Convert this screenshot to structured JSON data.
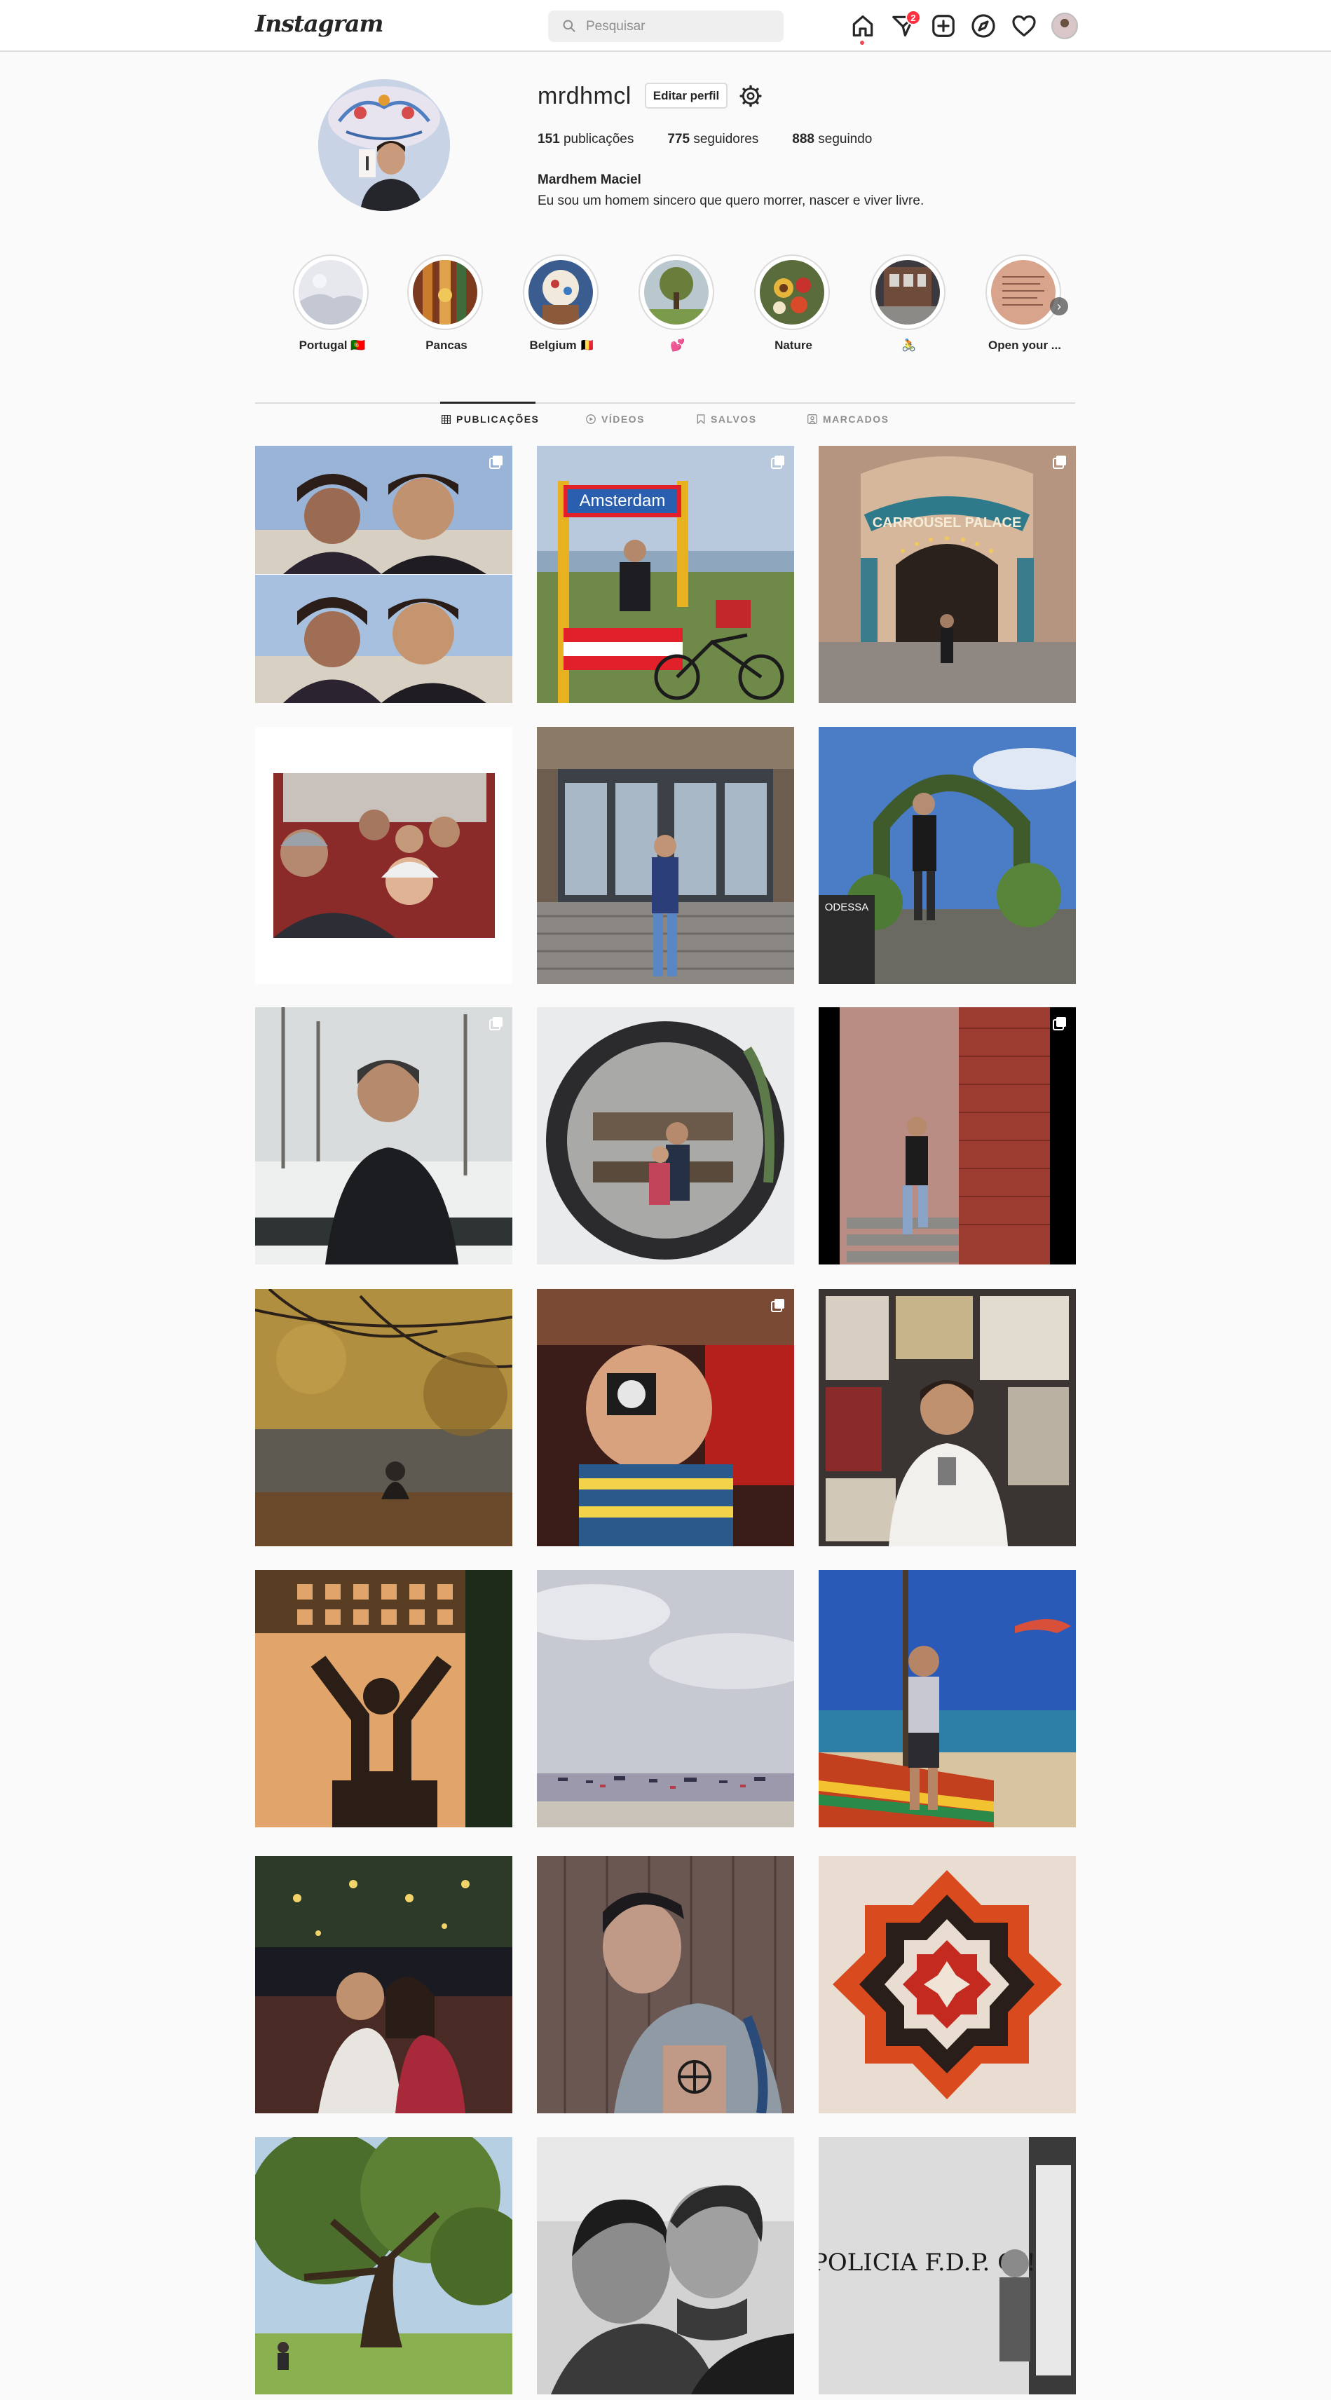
{
  "nav": {
    "logo": "Instagram",
    "search_placeholder": "Pesquisar",
    "notification_count": "2",
    "icons": [
      "home-icon",
      "direct-icon",
      "new-post-icon",
      "explore-icon",
      "activity-icon"
    ]
  },
  "profile": {
    "username": "mrdhmcl",
    "edit_label": "Editar perfil",
    "posts_count": "151",
    "posts_label": "publicações",
    "followers_count": "775",
    "followers_label": "seguidores",
    "following_count": "888",
    "following_label": "seguindo",
    "full_name": "Mardhem Maciel",
    "bio": "Eu sou um homem sincero que quero morrer, nascer e viver livre."
  },
  "highlights": [
    {
      "label": "Portugal 🇵🇹"
    },
    {
      "label": "Pancas"
    },
    {
      "label": "Belgium 🇧🇪"
    },
    {
      "label": "💕"
    },
    {
      "label": "Nature"
    },
    {
      "label": "🚴"
    },
    {
      "label": "Open your ..."
    }
  ],
  "tabs": [
    {
      "label": "PUBLICAÇÕES",
      "active": true
    },
    {
      "label": "VÍDEOS",
      "active": false
    },
    {
      "label": "SALVOS",
      "active": false
    },
    {
      "label": "MARCADOS",
      "active": false
    }
  ],
  "posts": [
    {
      "subject": "couple selfie at beach",
      "multi": true
    },
    {
      "subject": "Amsterdam sign with bicycle",
      "sign_text": "Amsterdam",
      "multi": true
    },
    {
      "subject": "Carrousel Palace entrance",
      "sign_text": "CARROUSEL PALACE",
      "multi": true
    },
    {
      "subject": "family selfie in tram",
      "multi": false
    },
    {
      "subject": "man in front of glass doors",
      "multi": false
    },
    {
      "subject": "man under garden arch",
      "sign_text": "ODESSA",
      "multi": false
    },
    {
      "subject": "man in snowy park",
      "multi": true
    },
    {
      "subject": "round mirror reflection",
      "multi": false
    },
    {
      "subject": "man on brick stairs",
      "multi": true
    },
    {
      "subject": "autumn lake silhouette",
      "multi": false
    },
    {
      "subject": "boy with monocle",
      "multi": true
    },
    {
      "subject": "man by poster wall",
      "multi": false
    },
    {
      "subject": "shadow on wall",
      "multi": false
    },
    {
      "subject": "boats on grey sea",
      "multi": false
    },
    {
      "subject": "man on boat at beach",
      "multi": false
    },
    {
      "subject": "couple kiss at night",
      "multi": false
    },
    {
      "subject": "man with tattoo",
      "multi": false
    },
    {
      "subject": "woven mandala",
      "multi": false
    },
    {
      "subject": "big tree in park",
      "multi": false
    },
    {
      "subject": "black and white kiss",
      "multi": false
    },
    {
      "subject": "graffiti wall",
      "sign_text": "POLICIA F.D.P. OI!",
      "multi": false
    }
  ]
}
